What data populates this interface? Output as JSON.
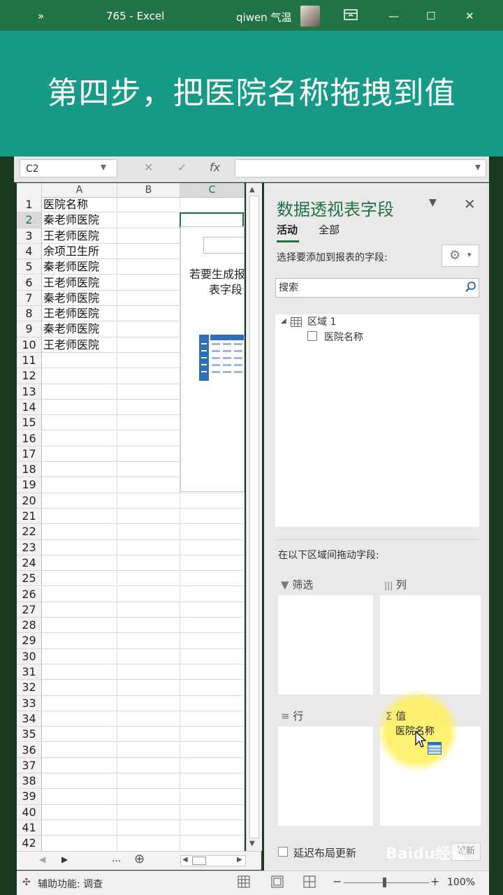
{
  "titlebar": {
    "chevron": "»",
    "title": "765  -  Excel",
    "user": "qiwen 气温",
    "ribbon_icon": "ribbon-display-icon",
    "min": "—",
    "max": "☐",
    "close": "✕"
  },
  "banner": {
    "text": "第四步，把医院名称拖拽到值"
  },
  "formula_bar": {
    "name_box": "C2",
    "cancel": "✕",
    "enter": "✓",
    "fx": "fx",
    "value": ""
  },
  "sheet": {
    "columns": [
      "A",
      "B",
      "C"
    ],
    "rows": [
      {
        "n": "1",
        "a": "医院名称"
      },
      {
        "n": "2",
        "a": "秦老师医院"
      },
      {
        "n": "3",
        "a": "王老师医院"
      },
      {
        "n": "4",
        "a": "余项卫生所"
      },
      {
        "n": "5",
        "a": "秦老师医院"
      },
      {
        "n": "6",
        "a": "王老师医院"
      },
      {
        "n": "7",
        "a": "秦老师医院"
      },
      {
        "n": "8",
        "a": "王老师医院"
      },
      {
        "n": "9",
        "a": "秦老师医院"
      },
      {
        "n": "10",
        "a": "王老师医院"
      },
      {
        "n": "11",
        "a": ""
      },
      {
        "n": "12",
        "a": ""
      },
      {
        "n": "13",
        "a": ""
      },
      {
        "n": "14",
        "a": ""
      },
      {
        "n": "15",
        "a": ""
      },
      {
        "n": "16",
        "a": ""
      },
      {
        "n": "17",
        "a": ""
      },
      {
        "n": "18",
        "a": ""
      },
      {
        "n": "19",
        "a": ""
      },
      {
        "n": "20",
        "a": ""
      },
      {
        "n": "21",
        "a": ""
      },
      {
        "n": "22",
        "a": ""
      },
      {
        "n": "23",
        "a": ""
      },
      {
        "n": "24",
        "a": ""
      },
      {
        "n": "25",
        "a": ""
      },
      {
        "n": "26",
        "a": ""
      },
      {
        "n": "27",
        "a": ""
      },
      {
        "n": "28",
        "a": ""
      },
      {
        "n": "29",
        "a": ""
      },
      {
        "n": "30",
        "a": ""
      },
      {
        "n": "31",
        "a": ""
      },
      {
        "n": "32",
        "a": ""
      },
      {
        "n": "33",
        "a": ""
      },
      {
        "n": "34",
        "a": ""
      },
      {
        "n": "35",
        "a": ""
      },
      {
        "n": "36",
        "a": ""
      },
      {
        "n": "37",
        "a": ""
      },
      {
        "n": "38",
        "a": ""
      },
      {
        "n": "39",
        "a": ""
      },
      {
        "n": "40",
        "a": ""
      },
      {
        "n": "41",
        "a": ""
      },
      {
        "n": "42",
        "a": ""
      }
    ],
    "pivot_placeholder": {
      "line1": "若要生成报",
      "line2": "表字段"
    },
    "tabs": {
      "more": "...",
      "add": "⊕"
    }
  },
  "pivot_pane": {
    "title": "数据透视表字段",
    "tabs": [
      "活动",
      "全部"
    ],
    "choose_label": "选择要添加到报表的字段:",
    "search_placeholder": "搜索",
    "field_tree": {
      "table": "区域 1",
      "fields": [
        "医院名称"
      ]
    },
    "drag_label": "在以下区域间拖动字段:",
    "zones": {
      "filter": "筛选",
      "columns": "列",
      "rows": "行",
      "values": "值"
    },
    "dragging_field": "医院名称",
    "defer_label": "延迟布局更新",
    "update_button": "更新"
  },
  "status_bar": {
    "accessibility": "辅助功能: 调查",
    "zoom": "100%",
    "zoom_minus": "−",
    "zoom_plus": "+"
  },
  "watermark": "Baidu经验",
  "colors": {
    "excel_green": "#217346",
    "banner": "#179a88",
    "highlight": "#fff26e"
  }
}
